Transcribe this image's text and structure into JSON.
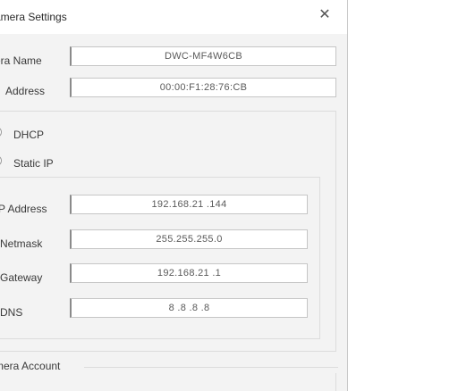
{
  "dialog": {
    "title": "amera Settings",
    "close_symbol": "✕"
  },
  "camera": {
    "name_label": "era Name",
    "name_value": "DWC-MF4W6CB",
    "mac_label": "Address",
    "mac_value": "00:00:F1:28:76:CB"
  },
  "network": {
    "dhcp_label": "DHCP",
    "dhcp_selected": false,
    "static_label": "Static IP",
    "static_selected": true,
    "ip_label": "P Address",
    "ip_value": "192.168.21 .144",
    "netmask_label": "Netmask",
    "netmask_value": "255.255.255.0",
    "gateway_label": "Gateway",
    "gateway_value": "192.168.21 .1",
    "dns_label": "DNS",
    "dns_value": "8 .8 .8 .8"
  },
  "account": {
    "legend": "mera Account"
  },
  "icons": {
    "close": "close-icon"
  }
}
